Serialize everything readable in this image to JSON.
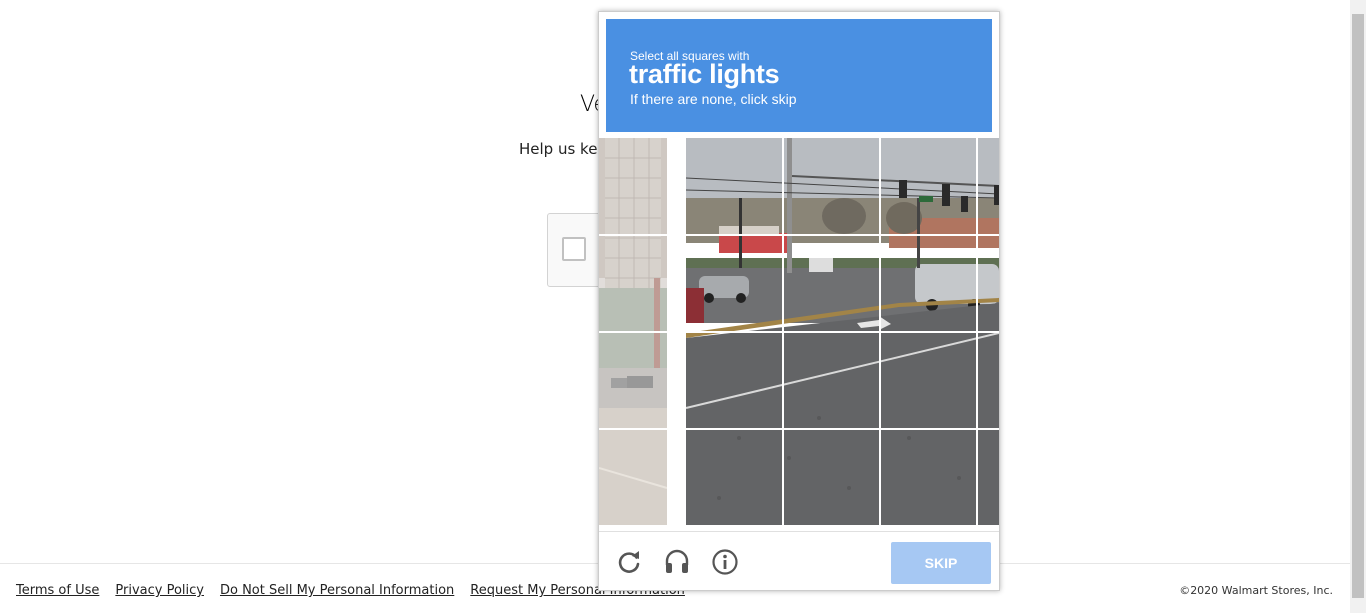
{
  "page": {
    "heading": "Ve",
    "subtext": "Help us kee"
  },
  "captcha": {
    "instruction_small": "Select all squares with",
    "target": "traffic lights",
    "instruction_skip": "If there are none, click skip",
    "skip_label": "SKIP",
    "header_color": "#4a90e2",
    "icons": [
      "reload-icon",
      "audio-icon",
      "info-icon"
    ],
    "grid": {
      "rows": 4,
      "cols": 4
    }
  },
  "footer": {
    "links": [
      "Terms of Use",
      "Privacy Policy",
      "Do Not Sell My Personal Information",
      "Request My Personal Information"
    ],
    "copyright": "©2020 Walmart Stores, Inc."
  }
}
